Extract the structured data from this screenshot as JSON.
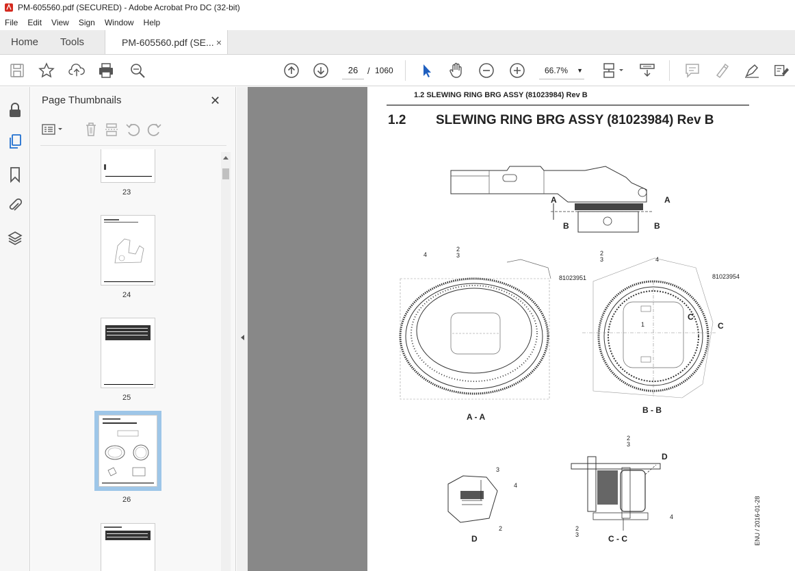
{
  "window": {
    "title": "PM-605560.pdf (SECURED) - Adobe Acrobat Pro DC (32-bit)"
  },
  "menu": [
    "File",
    "Edit",
    "View",
    "Sign",
    "Window",
    "Help"
  ],
  "tabs": {
    "home": "Home",
    "tools": "Tools",
    "document": "PM-605560.pdf (SE...",
    "close": "×"
  },
  "toolbar": {
    "current_page": "26",
    "page_sep": "/",
    "total_pages": "1060",
    "zoom": "66.7%",
    "zoom_arrow": "▼"
  },
  "panel": {
    "title": "Page Thumbnails",
    "close": "✕",
    "thumbnails": [
      {
        "page": "23"
      },
      {
        "page": "24"
      },
      {
        "page": "25"
      },
      {
        "page": "26",
        "selected": true
      }
    ]
  },
  "document": {
    "header": "1.2 SLEWING RING BRG ASSY (81023984) Rev B",
    "section_number": "1.2",
    "section_title": "SLEWING RING BRG ASSY (81023984) Rev B",
    "labels": {
      "view_aa": "A - A",
      "view_bb": "B - B",
      "view_d": "D",
      "view_cc": "C - C",
      "a": "A",
      "b": "B",
      "c": "C",
      "d": "D",
      "part1": "81023951",
      "part2": "81023954",
      "n1": "1",
      "n2": "2",
      "n3": "3",
      "n4": "4"
    },
    "side_code": "ENU / 2016-01-28"
  }
}
